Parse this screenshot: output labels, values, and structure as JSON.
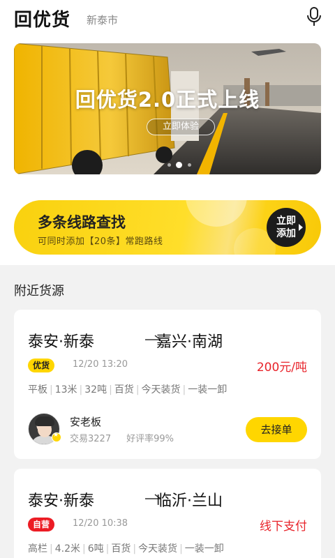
{
  "header": {
    "title": "回优货",
    "city": "新泰市",
    "mic_icon": "microphone-icon"
  },
  "banner": {
    "title": "回优货2.0正式上线",
    "button_label": "立即体验",
    "pages": 3,
    "active_page": 2
  },
  "route_card": {
    "title": "多条线路查找",
    "subtitle": "可同时添加【20条】常跑路线",
    "add_line1": "立即",
    "add_line2": "添加"
  },
  "section": {
    "title": "附近货源"
  },
  "cargo": [
    {
      "origin": "泰安·新泰",
      "destination": "嘉兴·南湖",
      "badge": "优货",
      "badge_color": "#ffd600",
      "time": "12/20 13:20",
      "price": "200元/吨",
      "tags": [
        "平板",
        "13米",
        "32吨",
        "百货",
        "今天装货",
        "一装一卸"
      ],
      "owner": "安老板",
      "deals": "交易3227",
      "rating": "好评率99%",
      "accept_label": "去接单"
    },
    {
      "origin": "泰安·新泰",
      "destination": "临沂·兰山",
      "badge": "自营",
      "badge_color": "#ec1c24",
      "time": "12/20 10:38",
      "price": "线下支付",
      "tags": [
        "高栏",
        "4.2米",
        "6吨",
        "百货",
        "今天装货",
        "一装一卸"
      ]
    }
  ]
}
